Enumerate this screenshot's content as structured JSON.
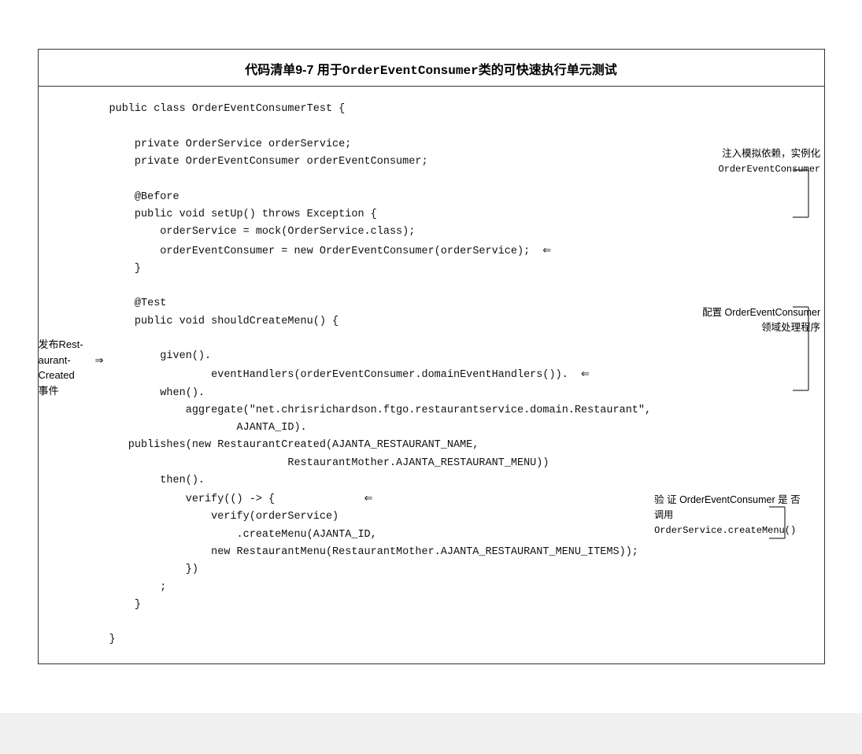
{
  "title": {
    "prefix": "代码清单9-7   用于",
    "classname": "OrderEventConsumer",
    "suffix": "类的可快速执行单元测试"
  },
  "code": {
    "lines": [
      "public class OrderEventConsumerTest {",
      "",
      "    private OrderService orderService;",
      "    private OrderEventConsumer orderEventConsumer;",
      "",
      "    @Before",
      "    public void setUp() throws Exception {",
      "        orderService = mock(OrderService.class);",
      "        orderEventConsumer = new OrderEventConsumer(orderService);",
      "    }",
      "",
      "    @Test",
      "    public void shouldCreateMenu() {",
      "",
      "        given().",
      "                eventHandlers(orderEventConsumer.domainEventHandlers()).",
      "        when().",
      "            aggregate(\"net.chrisrichardson.ftgo.restaurantservice.domain.Restaurant\",",
      "                    AJANTA_ID).",
      "⇒  publishes(new RestaurantCreated(AJANTA_RESTAURANT_NAME,",
      "                            RestaurantMother.AJANTA_RESTAURANT_MENU))",
      "        then().",
      "            verify(() -> {",
      "                verify(orderService)",
      "                    .createMenu(AJANTA_ID,",
      "                new RestaurantMenu(RestaurantMother.AJANTA_RESTAURANT_MENU_ITEMS));",
      "            })",
      "        ;",
      "    }",
      "",
      "}"
    ]
  },
  "annotations": {
    "annotation1": {
      "line1": "注入模拟依赖，实例化",
      "line2": "OrderEventConsumer"
    },
    "annotation2": {
      "line1": "配置 OrderEventConsumer",
      "line2": "领域处理程序"
    },
    "annotation3": {
      "line1": "验 证 OrderEventConsumer 是 否",
      "line2": "调用 OrderService.createMenu()"
    },
    "left_annotation": {
      "line1": "发布Rest-",
      "line2": "aurant-",
      "line3": "Created",
      "line4": "事件"
    }
  }
}
